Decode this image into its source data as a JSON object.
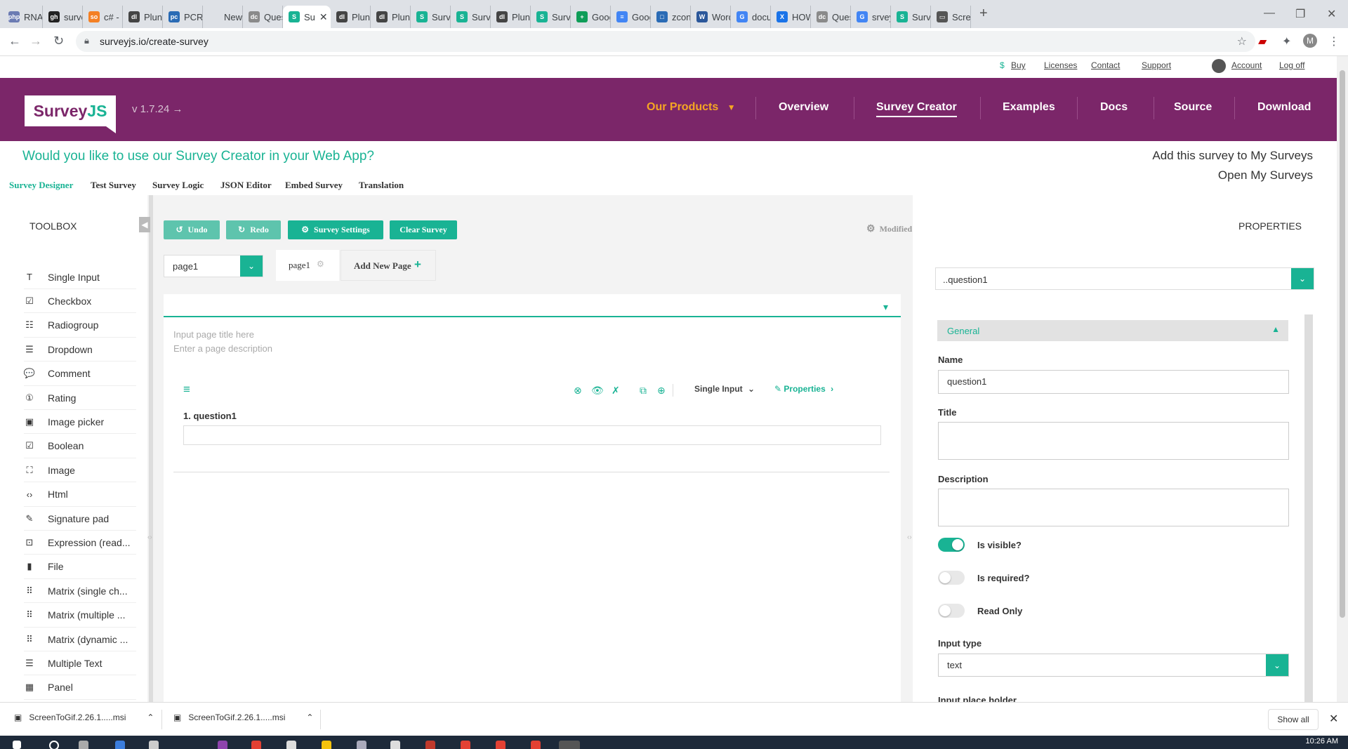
{
  "browser": {
    "tabs": [
      {
        "label": "RNA",
        "fav": "php",
        "color": "#6b7bb3"
      },
      {
        "label": "surve",
        "fav": "gh",
        "color": "#222222"
      },
      {
        "label": "c# - H",
        "fav": "so",
        "color": "#f48024"
      },
      {
        "label": "Plunk",
        "fav": "dl",
        "color": "#444444"
      },
      {
        "label": "PCRB",
        "fav": "pc",
        "color": "#2a6bb5"
      },
      {
        "label": "New Tab",
        "fav": "",
        "color": "#dee1e6"
      },
      {
        "label": "Quest",
        "fav": "dc",
        "color": "#8a8a8a"
      },
      {
        "label": "Su",
        "fav": "S",
        "color": "#19b394"
      },
      {
        "label": "Plunk",
        "fav": "dl",
        "color": "#444444"
      },
      {
        "label": "Plunk",
        "fav": "dl",
        "color": "#444444"
      },
      {
        "label": "Surve",
        "fav": "S",
        "color": "#19b394"
      },
      {
        "label": "Surve",
        "fav": "S",
        "color": "#19b394"
      },
      {
        "label": "Plunk",
        "fav": "dl",
        "color": "#444444"
      },
      {
        "label": "Surve",
        "fav": "S",
        "color": "#19b394"
      },
      {
        "label": "Goog",
        "fav": "+",
        "color": "#0f9d58"
      },
      {
        "label": "Goog",
        "fav": "≡",
        "color": "#4285f4"
      },
      {
        "label": "zcons",
        "fav": "□",
        "color": "#2a6bb5"
      },
      {
        "label": "Word",
        "fav": "W",
        "color": "#2b579a"
      },
      {
        "label": "docu",
        "fav": "G",
        "color": "#4285f4"
      },
      {
        "label": "HOW",
        "fav": "X",
        "color": "#1a73e8"
      },
      {
        "label": "Quest",
        "fav": "dc",
        "color": "#8a8a8a"
      },
      {
        "label": "srvey",
        "fav": "G",
        "color": "#4285f4"
      },
      {
        "label": "Surve",
        "fav": "S",
        "color": "#19b394"
      },
      {
        "label": "Scree",
        "fav": "▭",
        "color": "#555555"
      }
    ],
    "active_tab_index": 7,
    "new_tab": "+",
    "url": "surveyjs.io/create-survey"
  },
  "toplinks": {
    "buy": "Buy",
    "licenses": "Licenses",
    "contact": "Contact",
    "support": "Support",
    "account": "Account",
    "logoff": "Log off"
  },
  "header": {
    "logo_main": "Survey",
    "logo_accent": "JS",
    "version": "v 1.7.24 →",
    "nav": {
      "products": "Our Products",
      "overview": "Overview",
      "creator": "Survey Creator",
      "examples": "Examples",
      "docs": "Docs",
      "source": "Source",
      "download": "Download"
    }
  },
  "promo": {
    "text": "Would you like to use our Survey Creator in your Web App?",
    "add_link": "Add this survey to My Surveys",
    "open_link": "Open My Surveys"
  },
  "creator_tabs": [
    "Survey Designer",
    "Test Survey",
    "Survey Logic",
    "JSON Editor",
    "Embed Survey",
    "Translation"
  ],
  "toolbox": {
    "title": "TOOLBOX",
    "items": [
      {
        "label": "Single Input",
        "icon": "T"
      },
      {
        "label": "Checkbox",
        "icon": "☑"
      },
      {
        "label": "Radiogroup",
        "icon": "☷"
      },
      {
        "label": "Dropdown",
        "icon": "☰"
      },
      {
        "label": "Comment",
        "icon": "💬"
      },
      {
        "label": "Rating",
        "icon": "①"
      },
      {
        "label": "Image picker",
        "icon": "▣"
      },
      {
        "label": "Boolean",
        "icon": "☑"
      },
      {
        "label": "Image",
        "icon": "⛶"
      },
      {
        "label": "Html",
        "icon": "‹›"
      },
      {
        "label": "Signature pad",
        "icon": "✎"
      },
      {
        "label": "Expression (read...",
        "icon": "⊡"
      },
      {
        "label": "File",
        "icon": "▮"
      },
      {
        "label": "Matrix (single ch...",
        "icon": "⠿"
      },
      {
        "label": "Matrix (multiple ...",
        "icon": "⠿"
      },
      {
        "label": "Matrix (dynamic ...",
        "icon": "⠿"
      },
      {
        "label": "Multiple Text",
        "icon": "☰"
      },
      {
        "label": "Panel",
        "icon": "▦"
      }
    ]
  },
  "designer": {
    "undo": "Undo",
    "redo": "Redo",
    "settings": "Survey Settings",
    "clear": "Clear Survey",
    "modified": "Modified",
    "page_select": "page1",
    "page_tab": "page1",
    "add_page": "Add New Page",
    "page_title_placeholder": "Input page title here",
    "page_desc_placeholder": "Enter a page description",
    "question_title": "1. question1",
    "question_type": "Single Input",
    "question_properties": "Properties"
  },
  "properties": {
    "title": "PROPERTIES",
    "object_select": "..question1",
    "section": "General",
    "name_label": "Name",
    "name_value": "question1",
    "title_label": "Title",
    "description_label": "Description",
    "visible_label": "Is visible?",
    "required_label": "Is required?",
    "readonly_label": "Read Only",
    "input_type_label": "Input type",
    "input_type_value": "text",
    "placeholder_label": "Input place holder",
    "visible_on": true,
    "required_on": false,
    "readonly_on": false
  },
  "downloads": {
    "file1": "ScreenToGif.2.26.1.....msi",
    "file2": "ScreenToGif.2.26.1.....msi",
    "show_all": "Show all"
  },
  "taskbar": {
    "clock": "10:26 AM"
  },
  "colors": {
    "brand_purple": "#7b2669",
    "accent_green": "#19b394",
    "products_orange": "#f5a623"
  }
}
